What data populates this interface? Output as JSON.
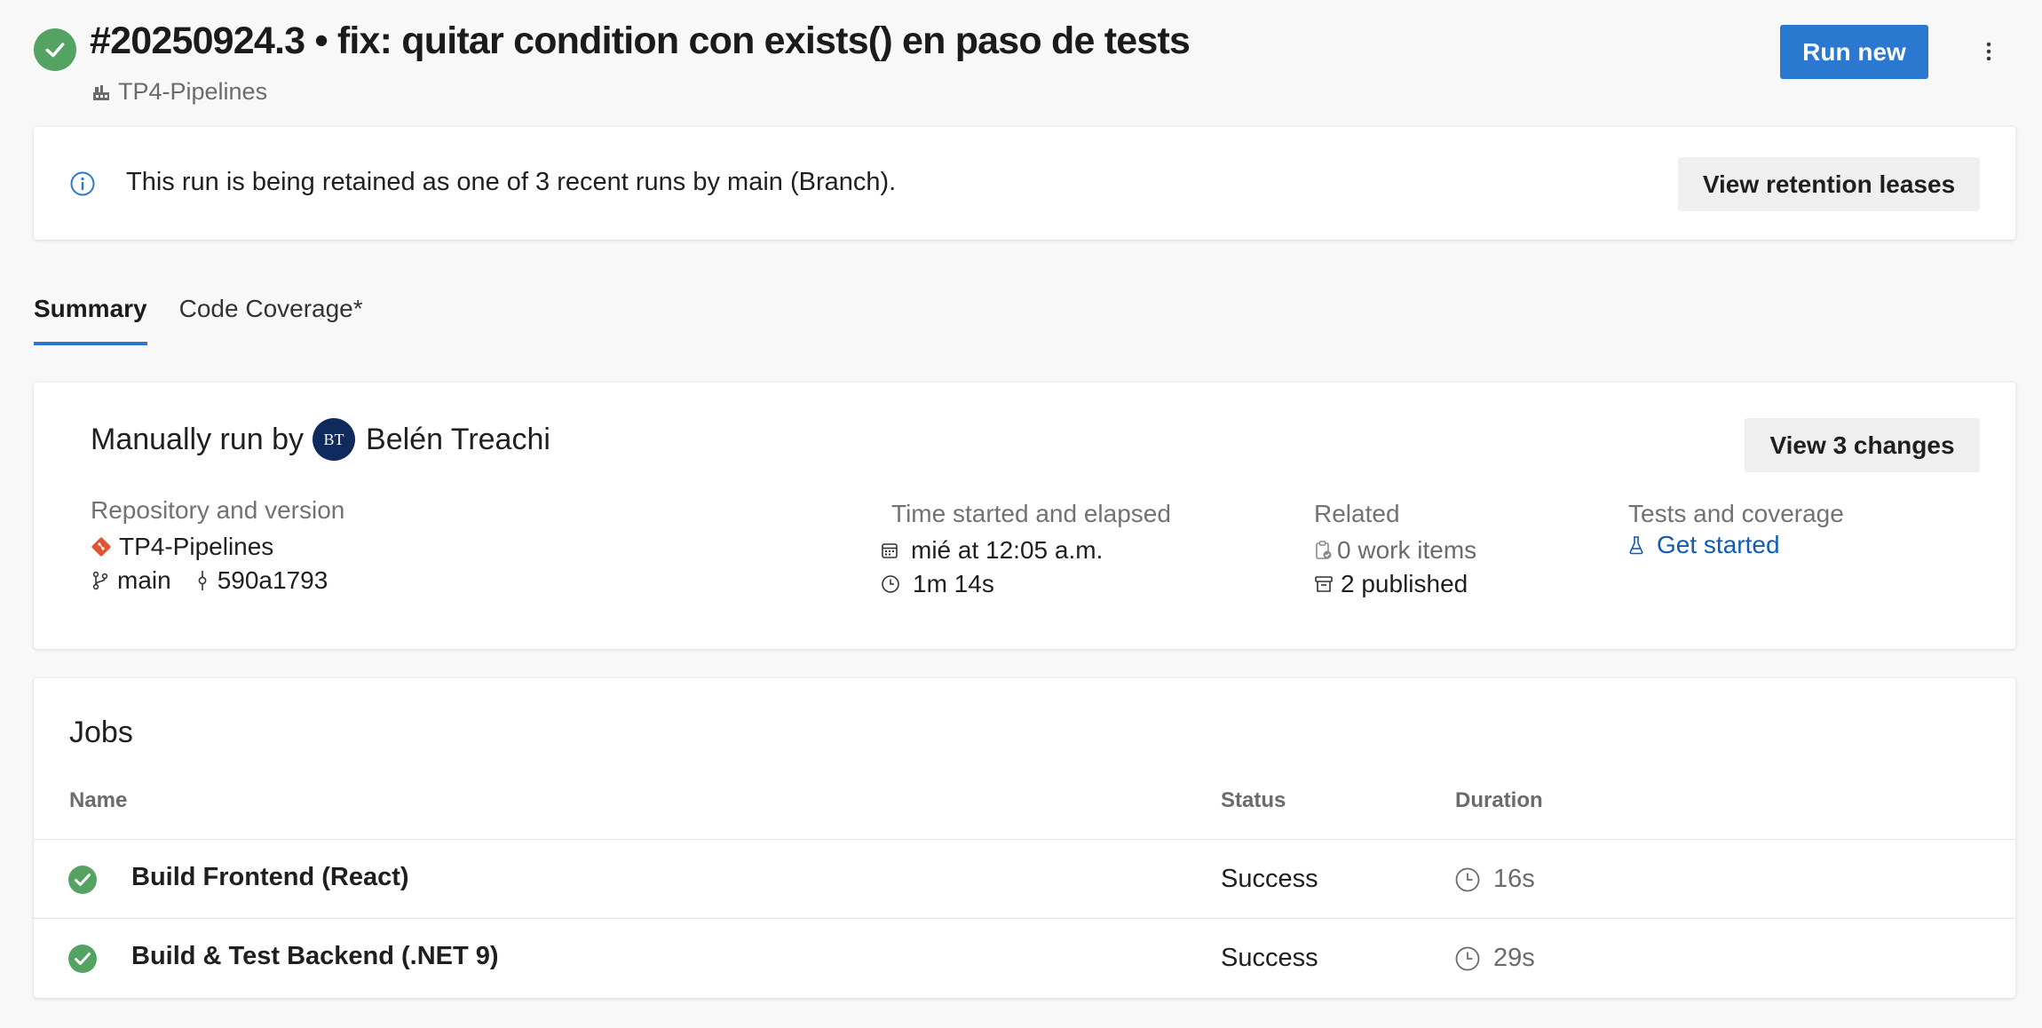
{
  "header": {
    "title": "#20250924.3 • fix: quitar condition con exists() en paso de tests",
    "pipeline": "TP4-Pipelines",
    "run_new_label": "Run new"
  },
  "banner": {
    "text": "This run is being retained as one of 3 recent runs by main (Branch).",
    "button_label": "View retention leases"
  },
  "tabs": [
    {
      "label": "Summary",
      "active": true
    },
    {
      "label": "Code Coverage*",
      "active": false
    }
  ],
  "summary": {
    "run_by_prefix": "Manually run by",
    "avatar_initials": "BT",
    "user": "Belén Treachi",
    "view_changes_label": "View 3 changes",
    "repository": {
      "label": "Repository and version",
      "repo": "TP4-Pipelines",
      "branch": "main",
      "commit": "590a1793"
    },
    "time": {
      "label": "Time started and elapsed",
      "started": "mié at 12:05 a.m.",
      "elapsed": "1m 14s"
    },
    "related": {
      "label": "Related",
      "work_items": "0 work items",
      "published": "2 published"
    },
    "tests": {
      "label": "Tests and coverage",
      "link": "Get started"
    }
  },
  "jobs": {
    "title": "Jobs",
    "columns": [
      "Name",
      "Status",
      "Duration"
    ],
    "rows": [
      {
        "name": "Build Frontend (React)",
        "status": "Success",
        "duration": "16s"
      },
      {
        "name": "Build & Test Backend (.NET 9)",
        "status": "Success",
        "duration": "29s"
      }
    ]
  },
  "colors": {
    "success": "#55a362",
    "accent": "#2a78d0",
    "link": "#0f5cb8",
    "avatar": "#0f2a5c",
    "git": "#e0552f"
  },
  "icons": [
    "check-icon",
    "pipeline-icon",
    "more-vertical-icon",
    "info-icon",
    "git-repo-icon",
    "branch-icon",
    "commit-icon",
    "calendar-icon",
    "clock-icon",
    "work-item-icon",
    "artifact-icon",
    "flask-icon"
  ]
}
